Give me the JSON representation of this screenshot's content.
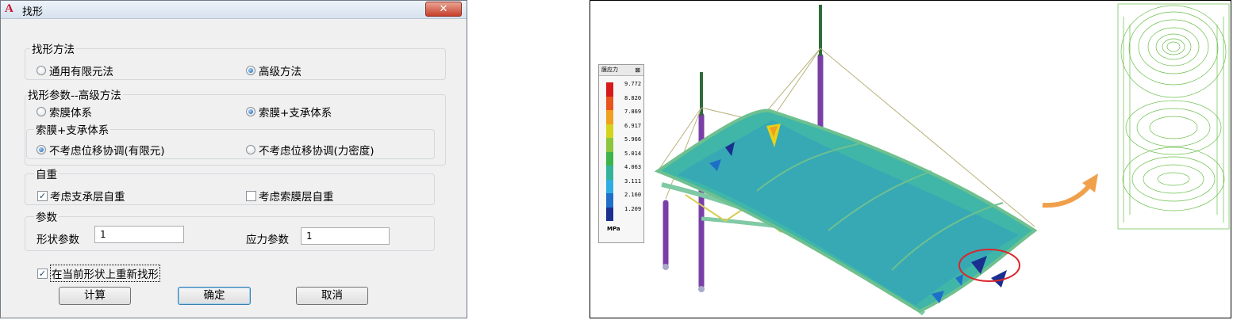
{
  "dialog": {
    "title": "找形",
    "close_label": "✕",
    "method_group": {
      "label": "找形方法",
      "options": [
        "通用有限元法",
        "高级方法"
      ],
      "selected": "高级方法"
    },
    "params_group": {
      "label": "找形参数--高级方法",
      "options": [
        "索膜体系",
        "索膜+支承体系"
      ],
      "selected": "索膜+支承体系",
      "subgroup": {
        "label": "索膜+支承体系",
        "options": [
          "不考虑位移协调(有限元)",
          "不考虑位移协调(力密度)"
        ],
        "selected": "不考虑位移协调(有限元)"
      }
    },
    "weight_group": {
      "label": "自重",
      "support_weight_label": "考虑支承层自重",
      "support_weight_checked": true,
      "membrane_weight_label": "考虑索膜层自重",
      "membrane_weight_checked": false
    },
    "param_group": {
      "label": "参数",
      "shape_label": "形状参数",
      "shape_value": "1",
      "stress_label": "应力参数",
      "stress_value": "1"
    },
    "refind_label": "在当前形状上重新找形",
    "refind_checked": true,
    "buttons": {
      "compute": "计算",
      "ok": "确定",
      "cancel": "取消"
    }
  },
  "figure": {
    "legend": {
      "title": "膜应力",
      "close": "⊠",
      "values": [
        "9.772",
        "8.820",
        "7.869",
        "6.917",
        "5.966",
        "5.014",
        "4.063",
        "3.111",
        "2.160",
        "1.209"
      ],
      "colors": [
        "#d7191c",
        "#e8541c",
        "#f0a01e",
        "#d4d41e",
        "#8cc63e",
        "#3cb44b",
        "#35b39a",
        "#2eaee0",
        "#1f6fc9",
        "#1a2f8f"
      ],
      "unit": "MPa"
    },
    "colors": {
      "membrane": "#3fb6a8",
      "frame": "#7fc9a4",
      "mast": "#7a3fa6",
      "arrow": "#f0a04b",
      "contour": "#6abf4b",
      "highlight": "#d9262c"
    }
  }
}
